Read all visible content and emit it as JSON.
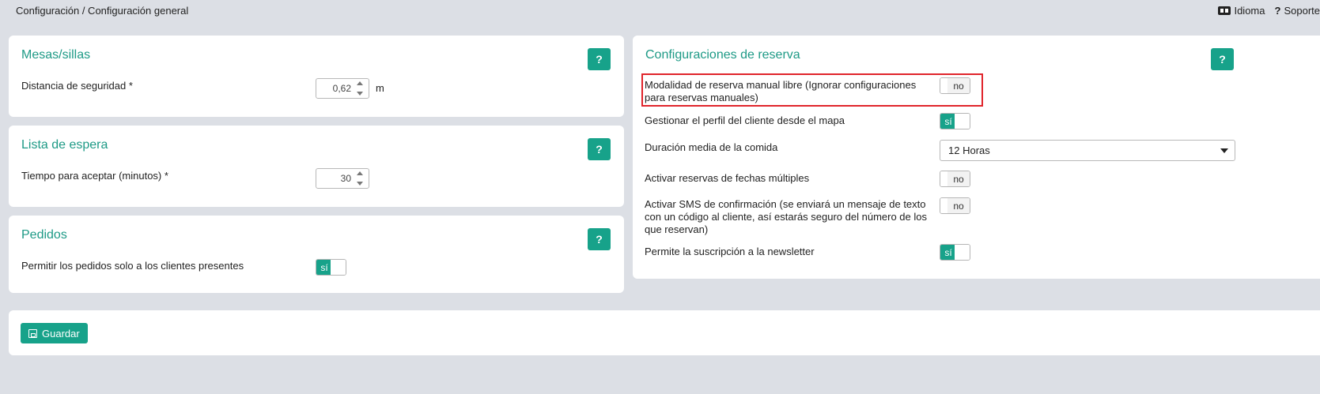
{
  "header": {
    "breadcrumb": "Configuración / Configuración general",
    "language_label": "Idioma",
    "language_icon": "language-icon",
    "support_label": "Soporte",
    "support_icon": "question-icon"
  },
  "colors": {
    "accent": "#17a28a",
    "title": "#1e9a86",
    "highlight": "#e0242b",
    "background": "#dcdfe5"
  },
  "tables_card": {
    "title": "Mesas/sillas",
    "help": "?",
    "safety_distance_label": "Distancia de seguridad  *",
    "safety_distance_value": "0,62",
    "safety_distance_unit": "m"
  },
  "waitlist_card": {
    "title": "Lista de espera",
    "help": "?",
    "accept_time_label": "Tiempo para aceptar (minutos)  *",
    "accept_time_value": "30"
  },
  "orders_card": {
    "title": "Pedidos",
    "help": "?",
    "present_only_label": "Permitir los pedidos solo a los clientes presentes",
    "present_only_value": "sí"
  },
  "reservation_card": {
    "title": "Configuraciones de reserva",
    "help": "?",
    "manual_free_label": "Modalidad de reserva manual libre (Ignorar configuraciones para reservas manuales)",
    "manual_free_value": "no",
    "client_profile_label": "Gestionar el perfil del cliente desde el mapa",
    "client_profile_value": "sí",
    "meal_duration_label": "Duración media de la comida",
    "meal_duration_value": "12 Horas",
    "multi_date_label": "Activar reservas de fechas múltiples",
    "multi_date_value": "no",
    "sms_label": "Activar SMS de confirmación (se enviará un mensaje de texto con un código al cliente, así estarás seguro del número de los que reservan)",
    "sms_value": "no",
    "newsletter_label": "Permite la suscripción a la newsletter",
    "newsletter_value": "sí"
  },
  "footer": {
    "save_label": "Guardar",
    "save_icon": "save-icon"
  }
}
